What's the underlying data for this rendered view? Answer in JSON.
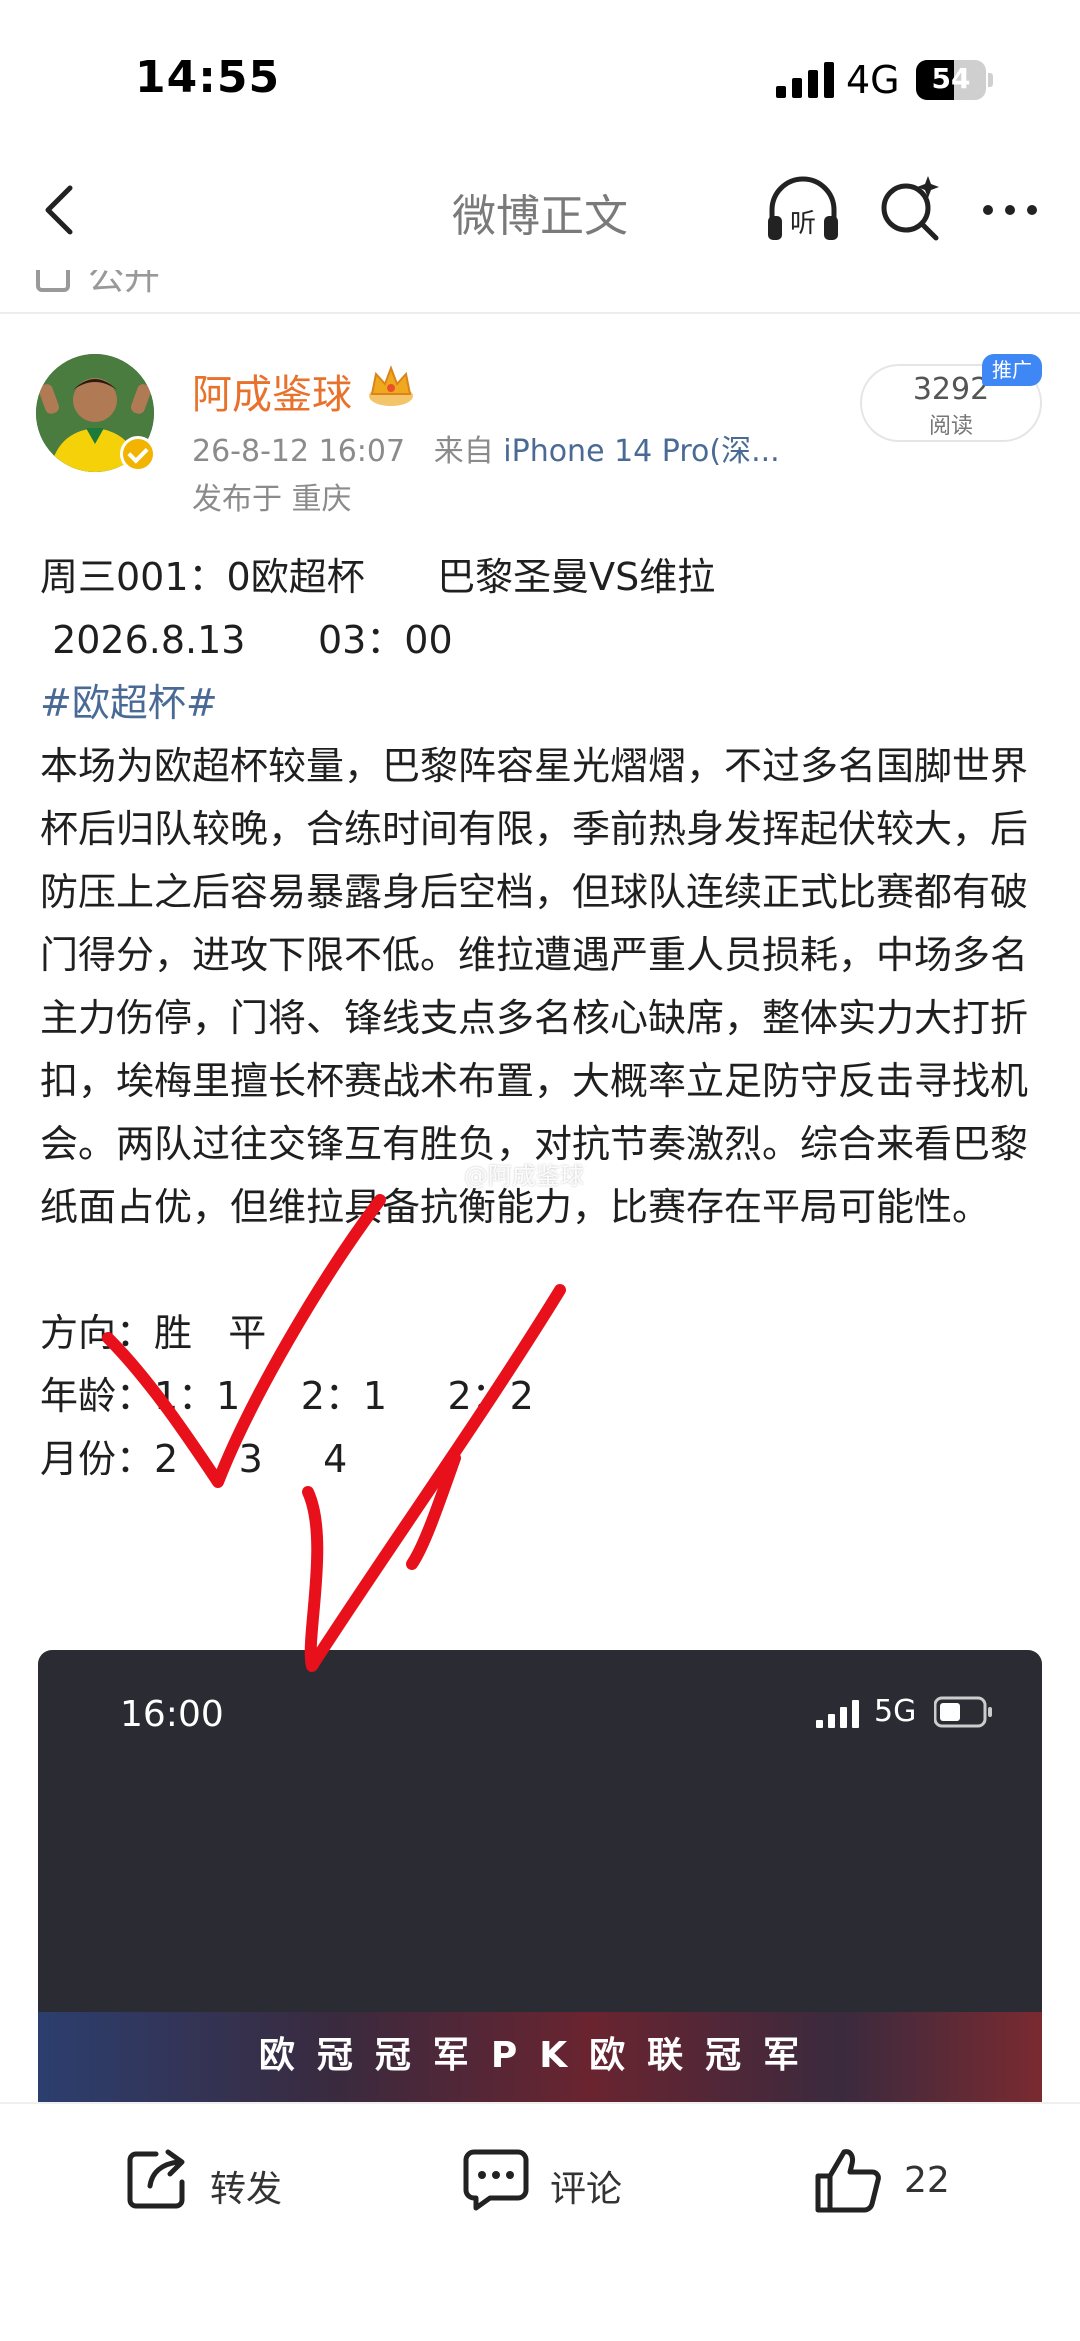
{
  "status_bar": {
    "time": "14:55",
    "network": "4G",
    "battery": "54",
    "battery_level": 0.54
  },
  "nav": {
    "title": "微博正文"
  },
  "partial_row": {
    "text": "公开"
  },
  "post": {
    "author": "阿成鉴球",
    "timestamp": "26-8-12 16:07",
    "source_prefix": "来自",
    "source": "iPhone 14 Pro(深...",
    "location": "发布于 重庆",
    "reads_count": "3292",
    "reads_label": "阅读",
    "promo_tag": "推广",
    "line1": "周三001：0欧超杯      巴黎圣曼VS维拉",
    "line2": " 2026.8.13      03：00",
    "hashtag": "#欧超杯#",
    "paragraph": "本场为欧超杯较量，巴黎阵容星光熠熠，不过多名国脚世界杯后归队较晚，合练时间有限，季前热身发挥起伏较大，后防压上之后容易暴露身后空档，但球队连续正式比赛都有破门得分，进攻下限不低。维拉遭遇严重人员损耗，中场多名主力伤停，门将、锋线支点多名核心缺席，整体实力大打折扣，埃梅里擅长杯赛战术布置，大概率立足防守反击寻找机会。两队过往交锋互有胜负，对抗节奏激烈。综合来看巴黎纸面占优，但维拉具备抗衡能力，比赛存在平局可能性。",
    "direction": "方向：胜   平",
    "age": "年龄：1：1     2：1     2：2",
    "month": "月份：2     3     4",
    "watermark": "@阿成鉴球"
  },
  "embedded_image": {
    "time": "16:00",
    "network": "5G",
    "banner": "欧冠冠军PK欧联冠军"
  },
  "actions": {
    "repost": "转发",
    "comment": "评论",
    "like_count": "22"
  },
  "colors": {
    "author": "#e8712c",
    "link": "#4a6a96",
    "promo": "#3f87f5",
    "annotation": "#e8101a"
  }
}
